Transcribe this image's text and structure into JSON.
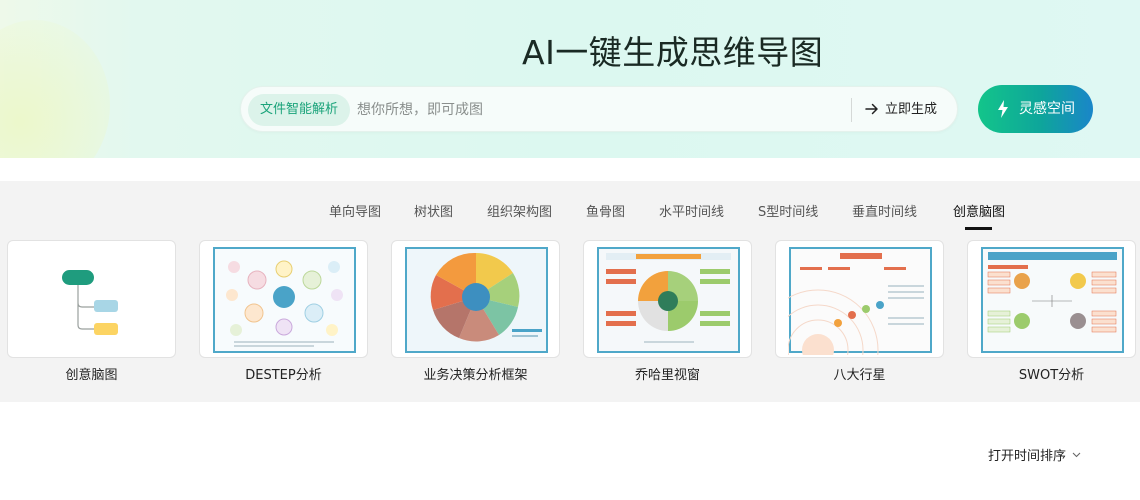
{
  "hero": {
    "title": "AI一键生成思维导图",
    "file_parse_tag": "文件智能解析",
    "search_placeholder": "想你所想，即可成图",
    "generate_label": "立即生成",
    "inspire_label": "灵感空间"
  },
  "tabs": [
    {
      "label": "单向导图",
      "active": false
    },
    {
      "label": "树状图",
      "active": false
    },
    {
      "label": "组织架构图",
      "active": false
    },
    {
      "label": "鱼骨图",
      "active": false
    },
    {
      "label": "水平时间线",
      "active": false
    },
    {
      "label": "S型时间线",
      "active": false
    },
    {
      "label": "垂直时间线",
      "active": false
    },
    {
      "label": "创意脑图",
      "active": true
    }
  ],
  "templates": [
    {
      "label": "创意脑图"
    },
    {
      "label": "DESTEP分析"
    },
    {
      "label": "业务决策分析框架"
    },
    {
      "label": "乔哈里视窗"
    },
    {
      "label": "八大行星"
    },
    {
      "label": "SWOT分析"
    }
  ],
  "sort": {
    "label": "打开时间排序"
  },
  "colors": {
    "accent": "#1aa37a",
    "mint_bg": "#dcf8f0",
    "panel_bg": "#f3f3f3"
  }
}
